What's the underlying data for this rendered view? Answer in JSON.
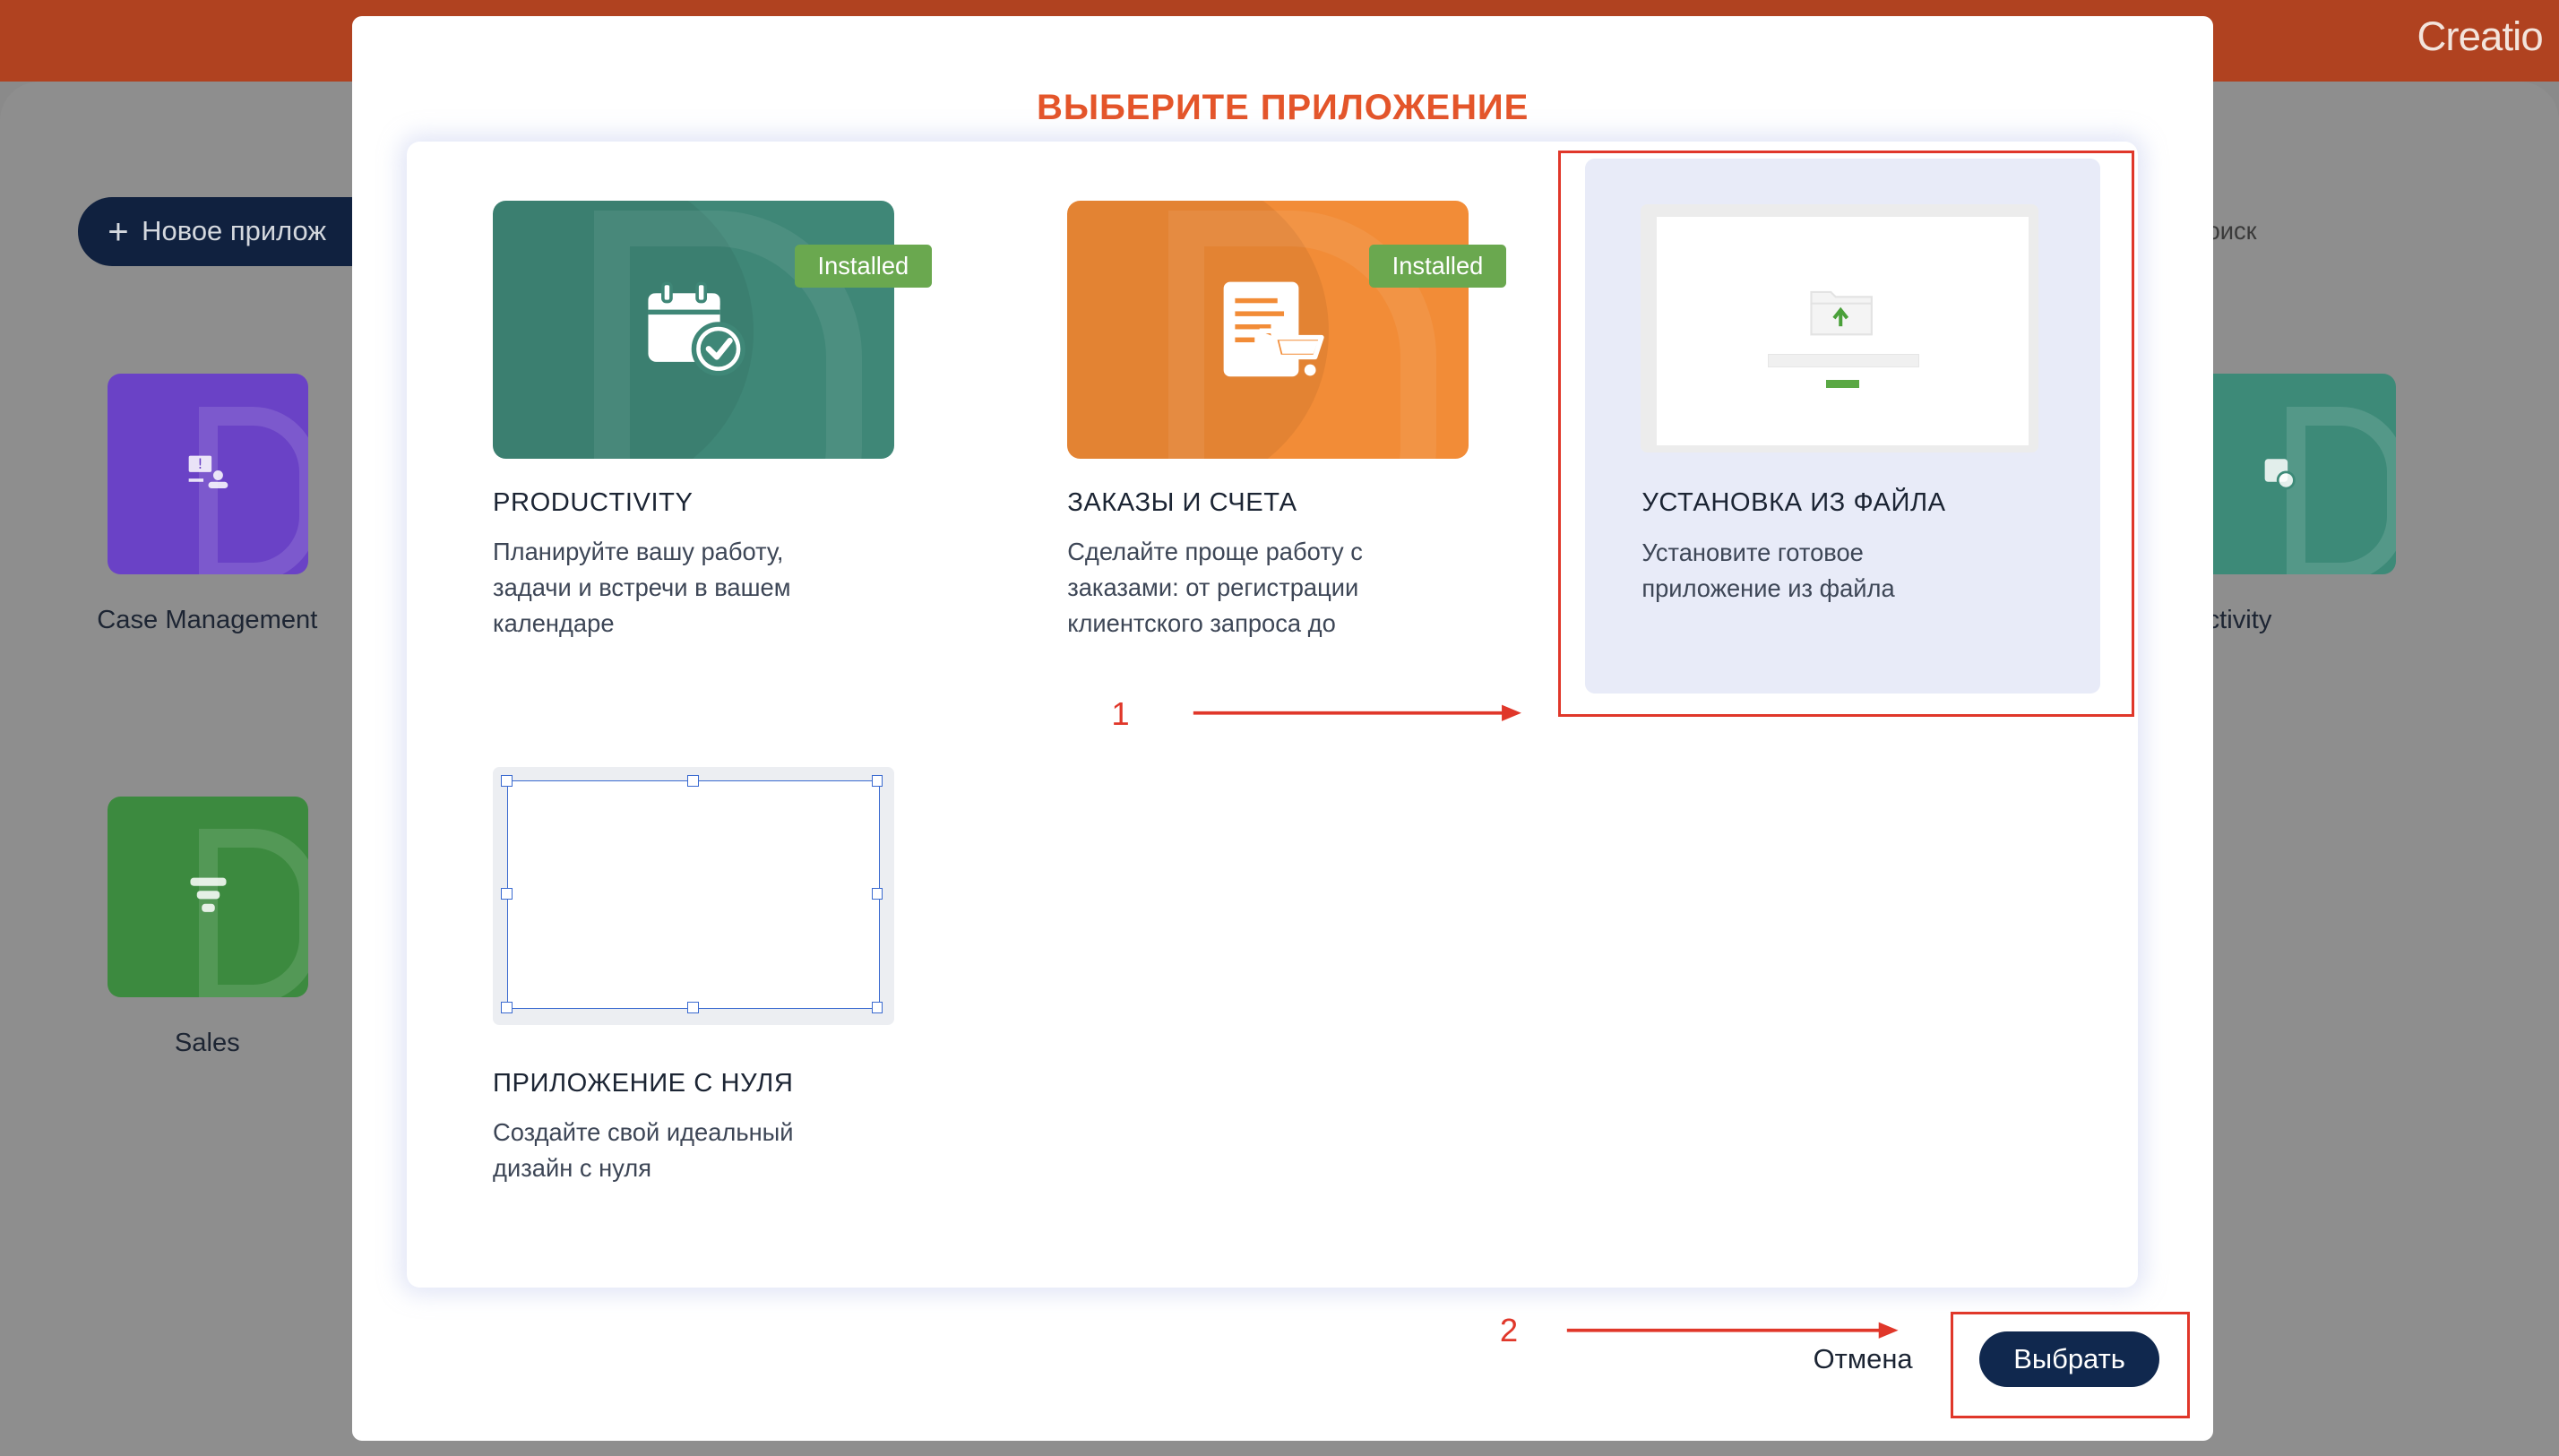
{
  "background": {
    "logo": "Creatio",
    "new_app_button": "Новое прилож",
    "search_text": "оиск",
    "tiles": [
      {
        "label": "Case Management",
        "color": "#6a42c6"
      },
      {
        "label": "Sales",
        "color": "#3c8a3f"
      },
      {
        "label": "ctivity",
        "color": "#3d8a78"
      }
    ]
  },
  "modal": {
    "title": "ВЫБЕРИТЕ ПРИЛОЖЕНИЕ",
    "cards": [
      {
        "title": "PRODUCTIVITY",
        "badge": "Installed",
        "desc": "Планируйте вашу работу, задачи и встречи в вашем календаре",
        "icon": "calendar-check-icon",
        "color": "#3f8777"
      },
      {
        "title": "ЗАКАЗЫ И СЧЕТА",
        "badge": "Installed",
        "desc": "Сделайте проще работу с заказами: от регистрации клиентского запроса до",
        "icon": "order-cart-icon",
        "color": "#f28c37"
      },
      {
        "title": "УСТАНОВКА ИЗ ФАЙЛА",
        "desc": "Установите готовое приложение из файла",
        "icon": "folder-upload-icon",
        "selected": true
      },
      {
        "title": "ПРИЛОЖЕНИЕ С НУЛЯ",
        "desc": "Создайте свой идеальный дизайн с нуля",
        "icon": "blank-canvas-icon"
      }
    ],
    "annotations": {
      "step1": "1",
      "step2": "2"
    },
    "footer": {
      "cancel": "Отмена",
      "select": "Выбрать"
    }
  },
  "colors": {
    "accent": "#e4552a",
    "primary_button": "#10284e",
    "badge": "#6aa84f",
    "annotation": "#e0372a"
  }
}
